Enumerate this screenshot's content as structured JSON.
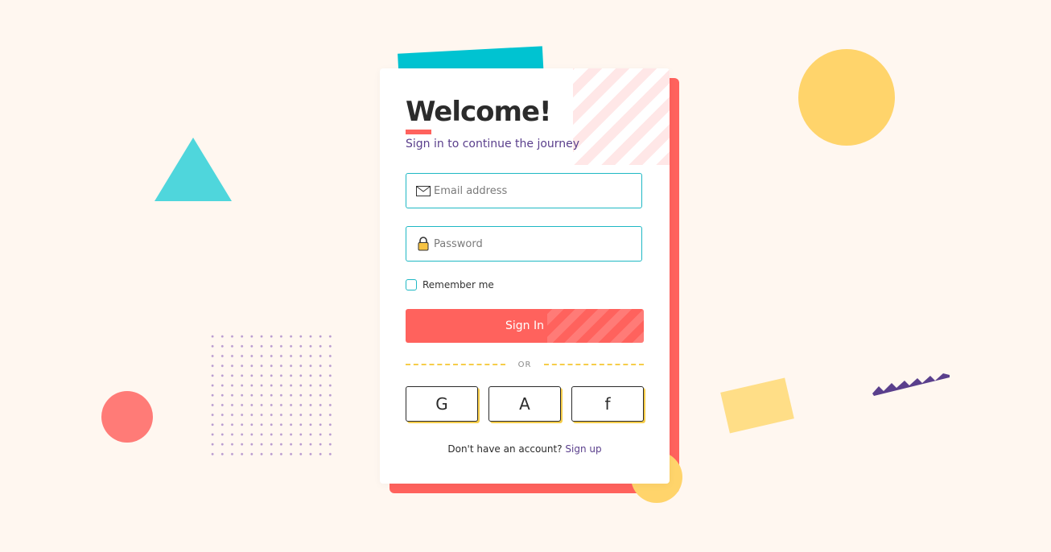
{
  "login": {
    "title": "Welcome!",
    "subtitle": "Sign in to continue the journey",
    "email_placeholder": "Email address",
    "password_placeholder": "Password",
    "remember_label": "Remember me",
    "signin_label": "Sign In",
    "or_label": "OR",
    "social": [
      {
        "label": "G",
        "icon": "google-icon"
      },
      {
        "label": "A",
        "icon": "apple-icon"
      },
      {
        "label": "f",
        "icon": "facebook-icon"
      }
    ],
    "footer_text": "Don't have an account?",
    "signup_label": "Sign up"
  },
  "colors": {
    "background": "#fff7f0",
    "accent_red": "#ff625d",
    "accent_cyan": "#00c3d1",
    "accent_yellow": "#ffd46b",
    "accent_purple": "#5a3f8c"
  }
}
